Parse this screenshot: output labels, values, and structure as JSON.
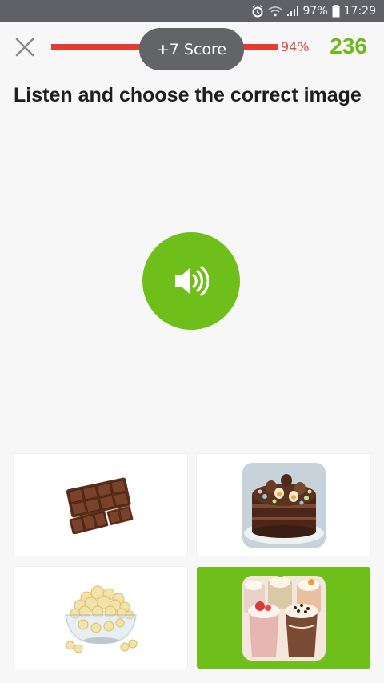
{
  "status_bar": {
    "battery": "97%",
    "time": "17:29",
    "icons": [
      "alarm-icon",
      "wifi-icon",
      "signal-icon",
      "battery-icon"
    ]
  },
  "header": {
    "close_icon": "close-icon",
    "progress_percent": 94,
    "progress_label": "94%",
    "score": "236",
    "toast": "+7 Score",
    "colors": {
      "progress": "#e53b35",
      "score": "#6fb81e"
    }
  },
  "question": {
    "prompt": "Listen and choose the correct image",
    "audio_icon": "speaker-icon",
    "accent_color": "#6fbf1b"
  },
  "options": [
    {
      "name": "chocolate-bar-image",
      "selected": false
    },
    {
      "name": "chocolate-egg-cake-image",
      "selected": false
    },
    {
      "name": "popcorn-bowl-image",
      "selected": false
    },
    {
      "name": "milkshakes-image",
      "selected": true
    }
  ]
}
